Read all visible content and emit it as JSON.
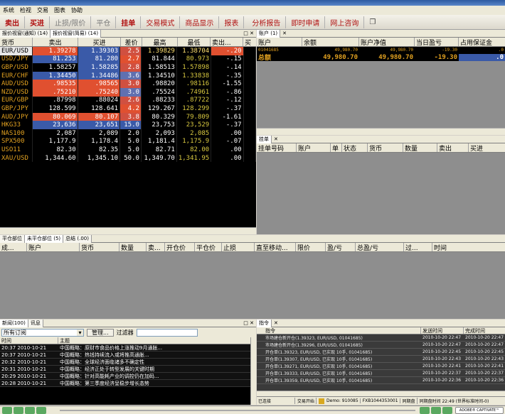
{
  "menu": [
    "系统",
    "检视",
    "交易",
    "图表",
    "协助"
  ],
  "toolbar": {
    "sell": "卖出",
    "buy": "买进",
    "stop": "止损/限价",
    "close": "平仓",
    "order": "挂单",
    "mode": "交易模式",
    "display": "商品显示",
    "report": "报表",
    "analysis": "分析报告",
    "apply": "即时申请",
    "consult": "网上咨询"
  },
  "quote_tabs": [
    "报价视窗(通知) (14)",
    "报价视窗(简易) (14)"
  ],
  "quote_cols": [
    "货币",
    "卖出",
    "买进",
    "差价",
    "最高",
    "最低",
    "卖出...",
    "买"
  ],
  "quotes": [
    {
      "sym": "EUR/USD",
      "sell": "1.39278",
      "buy": "1.39303",
      "spr": "2.5",
      "hi": "1.39829",
      "lo": "1.38704",
      "chg": "-.20"
    },
    {
      "sym": "USD/JPY",
      "sell": "81.253",
      "buy": "81.280",
      "spr": "2.7",
      "hi": "81.844",
      "lo": "80.973",
      "chg": "-.15"
    },
    {
      "sym": "GBP/USD",
      "sell": "1.58257",
      "buy": "1.58285",
      "spr": "2.8",
      "hi": "1.58513",
      "lo": "1.57898",
      "chg": "-.14"
    },
    {
      "sym": "EUR/CHF",
      "sell": "1.34450",
      "buy": "1.34486",
      "spr": "3.6",
      "hi": "1.34510",
      "lo": "1.33838",
      "chg": "-.35"
    },
    {
      "sym": "AUD/USD",
      "sell": ".98535",
      "buy": ".98565",
      "spr": "3.0",
      "hi": ".98820",
      "lo": ".98116",
      "chg": "-1.55"
    },
    {
      "sym": "NZD/USD",
      "sell": ".75210",
      "buy": ".75240",
      "spr": "3.0",
      "hi": ".75524",
      "lo": ".74961",
      "chg": "-.86"
    },
    {
      "sym": "EUR/GBP",
      "sell": ".87998",
      "buy": ".88024",
      "spr": "2.6",
      "hi": ".88233",
      "lo": ".87722",
      "chg": "-.12"
    },
    {
      "sym": "GBP/JPY",
      "sell": "128.599",
      "buy": "128.641",
      "spr": "4.2",
      "hi": "129.267",
      "lo": "128.299",
      "chg": "-.37"
    },
    {
      "sym": "AUD/JPY",
      "sell": "80.069",
      "buy": "80.107",
      "spr": "3.8",
      "hi": "80.329",
      "lo": "79.809",
      "chg": "-1.61"
    },
    {
      "sym": "HKG33",
      "sell": "23,636",
      "buy": "23,651",
      "spr": "15.0",
      "hi": "23,753",
      "lo": "23,529",
      "chg": "-.37"
    },
    {
      "sym": "NAS100",
      "sell": "2,087",
      "buy": "2,089",
      "spr": "2.0",
      "hi": "2,093",
      "lo": "2,085",
      "chg": ".00"
    },
    {
      "sym": "SPX500",
      "sell": "1,177.9",
      "buy": "1,178.4",
      "spr": "5.0",
      "hi": "1,181.4",
      "lo": "1,175.9",
      "chg": "-.07"
    },
    {
      "sym": "USO11",
      "sell": "82.30",
      "buy": "82.35",
      "spr": "5.0",
      "hi": "82.71",
      "lo": "82.00",
      "chg": ".00"
    },
    {
      "sym": "XAU/USD",
      "sell": "1,344.60",
      "buy": "1,345.10",
      "spr": "50.0",
      "hi": "1,349.70",
      "lo": "1,341.95",
      "chg": ".00"
    }
  ],
  "account": {
    "tab": "账户 (1)",
    "cols": [
      "账户",
      "余额",
      "账户净值",
      "当日盈亏",
      "占用保证金"
    ],
    "row": {
      "id": "01041685",
      "bal": "49,980.70",
      "eq": "49,980.70",
      "pl": "-19.30",
      "margin": ".0"
    },
    "total": {
      "label": "总额",
      "bal": "49,980.70",
      "eq": "49,980.70",
      "pl": "-19.30",
      "margin": ".0"
    }
  },
  "orders": {
    "tab": "挂单",
    "cols": [
      "挂单号码",
      "账户",
      "单",
      "状态",
      "货币",
      "数量",
      "卖出",
      "买进"
    ]
  },
  "positions": {
    "tabs": [
      "平仓部位",
      "未平仓部位 (5)",
      "总结 (.00)"
    ],
    "cols": [
      "成...",
      "账户",
      "货币",
      "数量",
      "卖...",
      "开仓价",
      "平仓价",
      "止损",
      "直至移动...",
      "限价",
      "盈/亏",
      "总盈/亏",
      "过...",
      "时间"
    ]
  },
  "news": {
    "tabs": [
      "新闻(100)",
      "讯息"
    ],
    "filter_select": "所有订阅",
    "manage": "管理...",
    "filter_label": "过滤器",
    "cols": [
      "时间",
      "主题"
    ],
    "rows": [
      {
        "t": "20:37 2010-10-21",
        "s": "中国概略：原财市食品价格上涨推动9月通胀..."
      },
      {
        "t": "20:37 2010-10-21",
        "s": "中国概略：热钱持续流入或将推高通胀..."
      },
      {
        "t": "20:32 2010-10-21",
        "s": "中国概略：全球经济面临诸多不确定性"
      },
      {
        "t": "20:31 2010-10-21",
        "s": "中国概略：经济正处于转型发展的关键时期"
      },
      {
        "t": "20:29 2010-10-21",
        "s": "中国概略：针对高能耗产业的调控仍在加码..."
      },
      {
        "t": "20:28 2010-10-21",
        "s": "中国概略：第三季度经济呈稳步增长态势"
      }
    ]
  },
  "commands": {
    "tab": "指令",
    "cols": [
      "指令",
      "发送时间",
      "完成时间"
    ],
    "rows": [
      {
        "c": "市场建仓新开仓(1.39323, EUR/USD, 01041685)",
        "a": "2010-10-20 22:47",
        "b": "2010-10-20 22:47"
      },
      {
        "c": "市场建仓新开仓(1.39296, EUR/USD, 01041685)",
        "a": "2010-10-20 22:47",
        "b": "2010-10-20 22:47"
      },
      {
        "c": "开仓单(1.39323, EUR/USD, 已实现 10手, 01041685)",
        "a": "2010-10-20 22:45",
        "b": "2010-10-20 22:45"
      },
      {
        "c": "开仓单(1.39307, EUR/USD, 已实现 10手, 01041685)",
        "a": "2010-10-20 22:43",
        "b": "2010-10-20 22:43"
      },
      {
        "c": "开仓单(1.39271, EUR/USD, 已实现 10手, 01041685)",
        "a": "2010-10-20 22:41",
        "b": "2010-10-20 22:41"
      },
      {
        "c": "开仓单(1.39333, EUR/USD, 已实现 10手, 01041685)",
        "a": "2010-10-20 22:37",
        "b": "2010-10-20 22:37"
      },
      {
        "c": "开仓单(1.39359, EUR/USD, 已实现 10手, 01041685)",
        "a": "2010-10-20 22:36",
        "b": "2010-10-20 22:36"
      }
    ]
  },
  "status": {
    "connected": "已连接",
    "trading": "交易开始",
    "demo": "Demo: 910085",
    "server": "FXB1044353001",
    "quotes": "同期盘",
    "clock": "同期盘时间 22:49 (世界标准时间-0)"
  },
  "captivate": "ADOBE® CAPTIVATE™",
  "colors": {
    "sell_bg": "#3a5aa8",
    "buy_hl": "#e05030",
    "symbol": "#e0a020",
    "low": "#d8c840",
    "brand": "#b01010"
  }
}
